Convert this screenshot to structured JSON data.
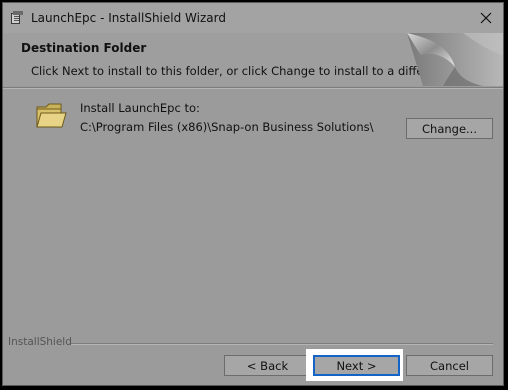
{
  "window": {
    "title": "LaunchEpc - InstallShield Wizard"
  },
  "banner": {
    "title": "Destination Folder",
    "subtitle": "Click Next to install to this folder, or click Change to install to a different folder."
  },
  "install": {
    "label": "Install LaunchEpc to:",
    "path": "C:\\Program Files (x86)\\Snap-on Business Solutions\\",
    "change_label": "Change..."
  },
  "footer": {
    "brand": "InstallShield",
    "back_label": "< Back",
    "next_label": "Next >",
    "cancel_label": "Cancel"
  },
  "icons": {
    "app": "installer-app-icon",
    "close": "close-icon",
    "folder": "folder-icon",
    "banner_art": "page-curl-banner-graphic"
  },
  "colors": {
    "focus_ring": "#1464c8",
    "focus_highlight": "#ffffff"
  }
}
